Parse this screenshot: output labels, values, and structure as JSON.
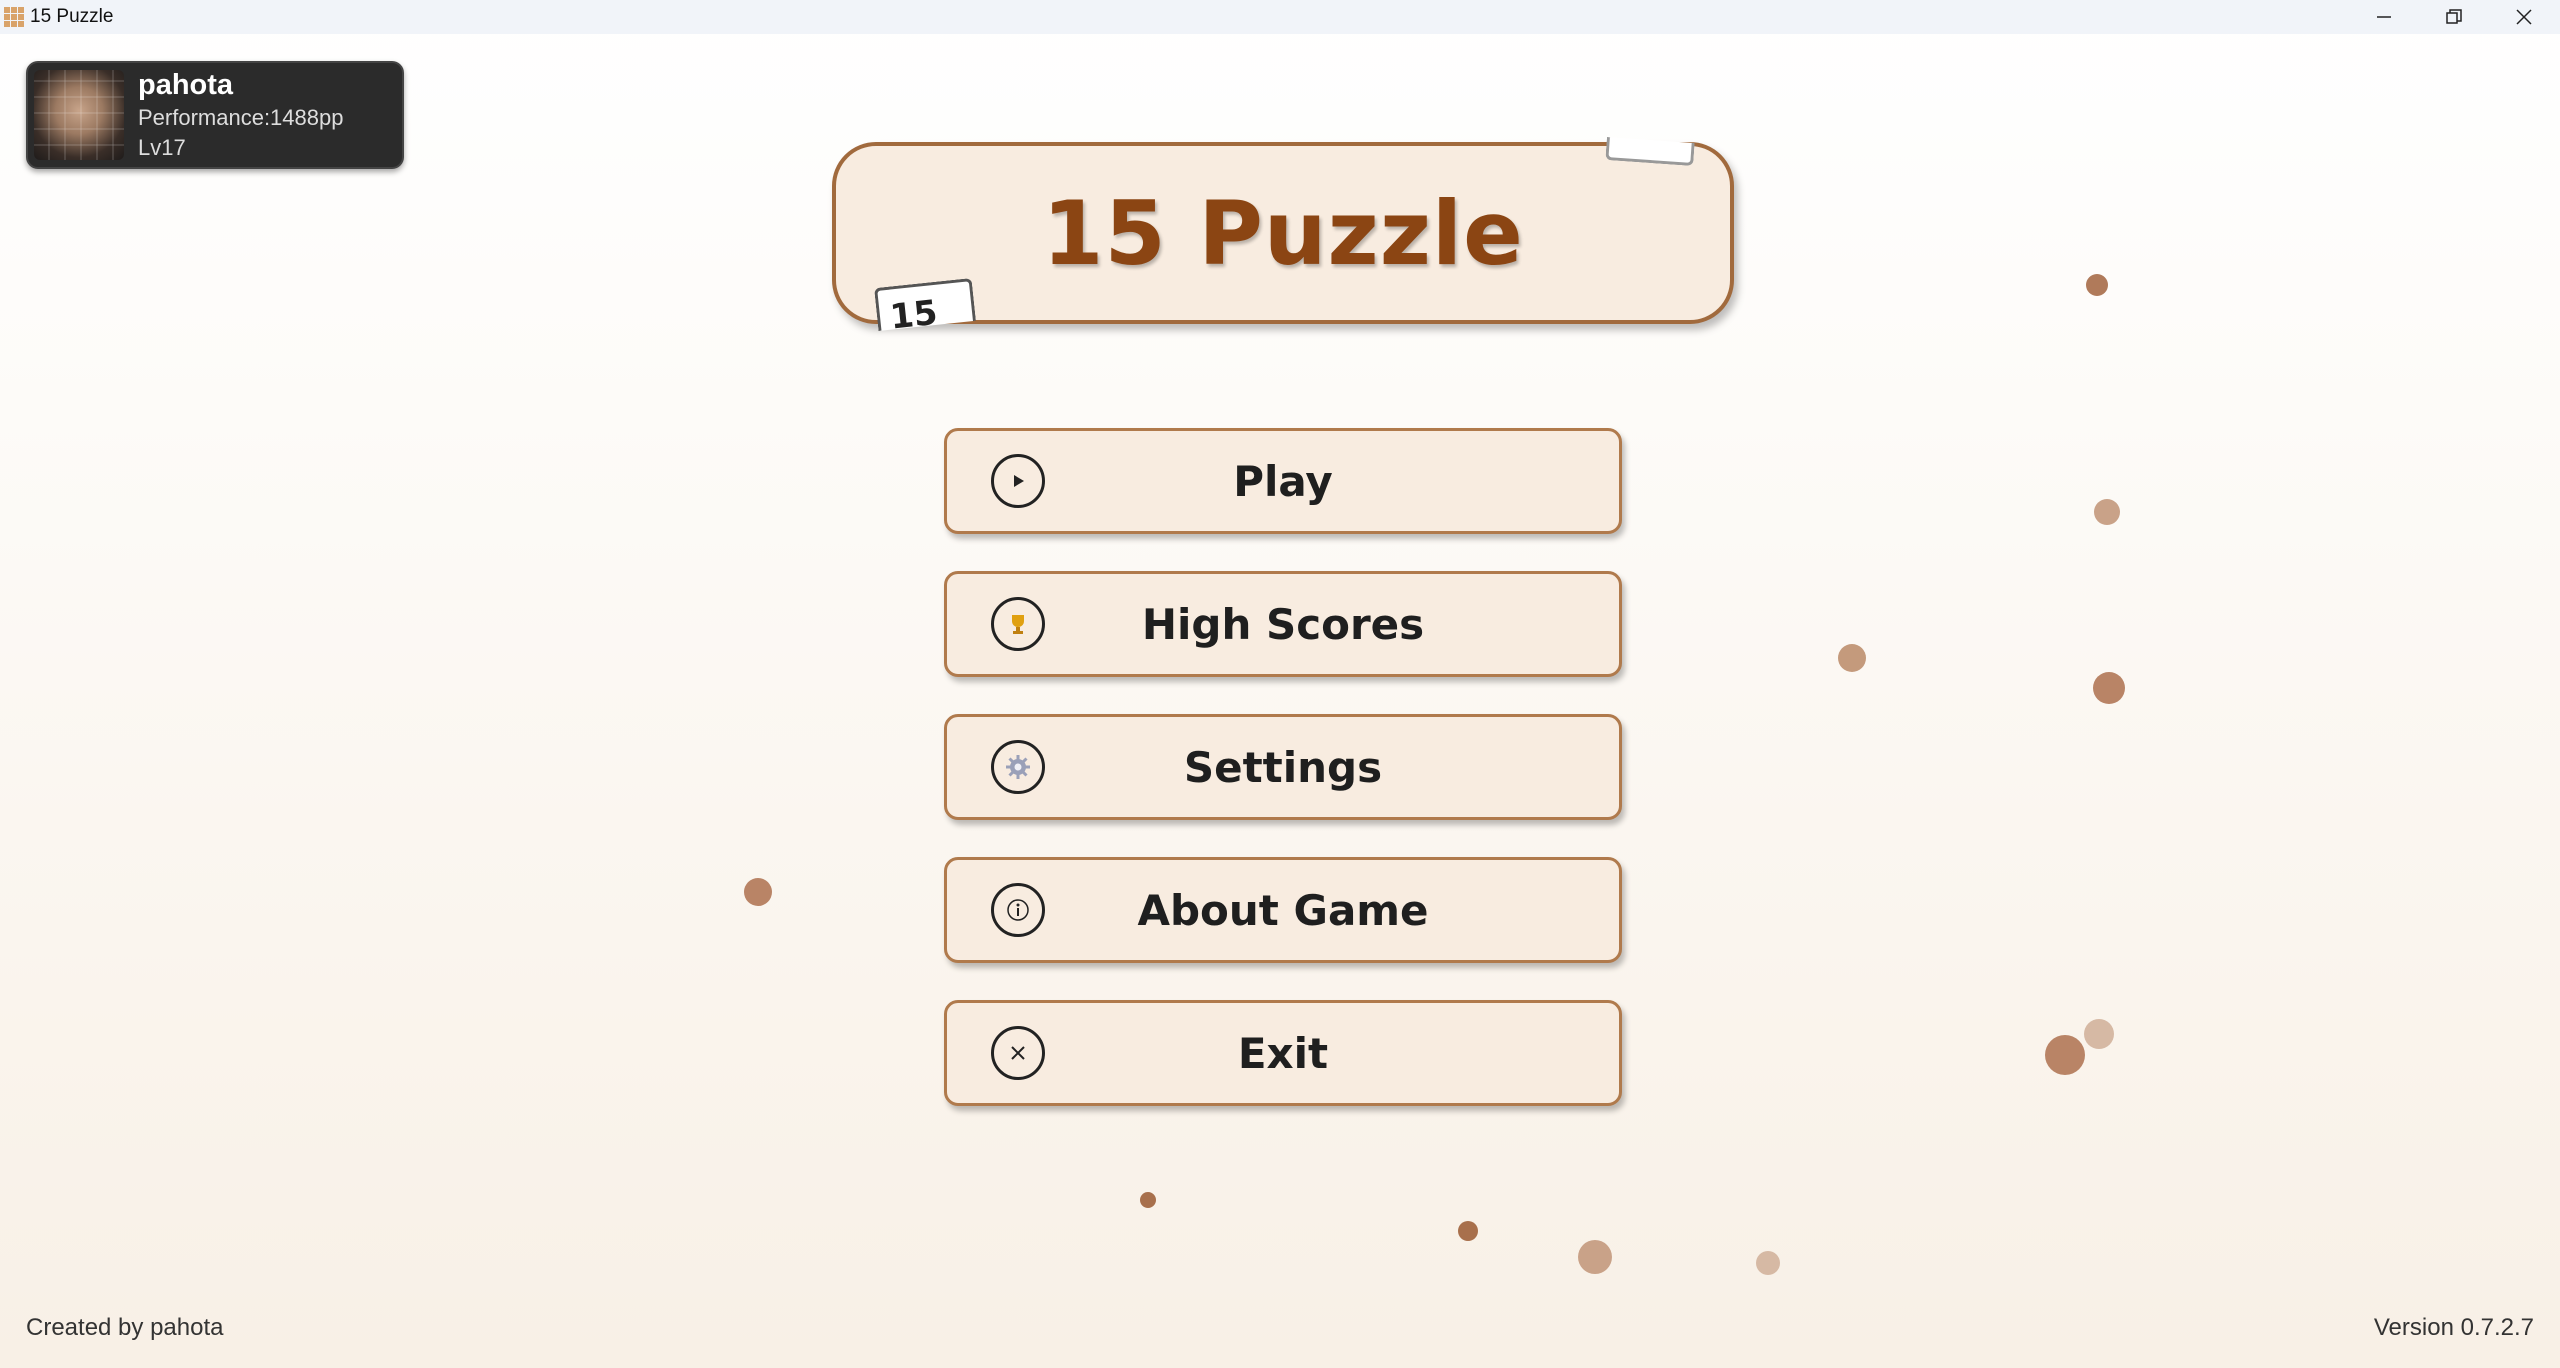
{
  "window": {
    "title": "15 Puzzle"
  },
  "profile": {
    "name": "pahota",
    "performance": "Performance:1488pp",
    "level": "Lv17"
  },
  "title_card": {
    "title": "15 Puzzle",
    "tile_number": "15"
  },
  "menu": [
    {
      "label": "Play",
      "icon": "play-icon"
    },
    {
      "label": "High Scores",
      "icon": "trophy-icon"
    },
    {
      "label": "Settings",
      "icon": "gear-icon"
    },
    {
      "label": "About Game",
      "icon": "info-icon"
    },
    {
      "label": "Exit",
      "icon": "close-icon"
    }
  ],
  "footer": {
    "credit": "Created by pahota",
    "version": "Version 0.7.2.7"
  },
  "colors": {
    "accent": "#8b4513",
    "button_bg": "#f8ece0",
    "button_border": "#b07a4c",
    "dot": "#b98a6a"
  }
}
